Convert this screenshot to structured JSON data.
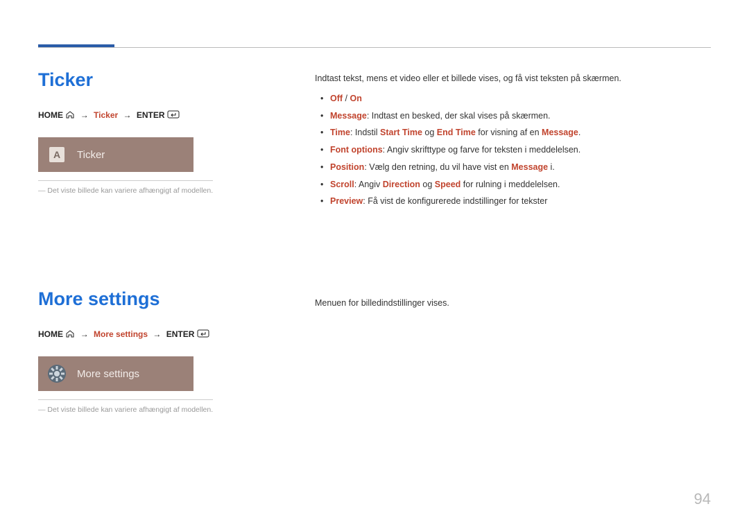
{
  "page_number": "94",
  "ticker": {
    "title": "Ticker",
    "breadcrumb": {
      "home": "HOME",
      "mid": "Ticker",
      "enter": "ENTER"
    },
    "tile_label": "Ticker",
    "tile_letter": "A",
    "note": "Det viste billede kan variere afhængigt af modellen.",
    "intro": "Indtast tekst, mens et video eller et billede vises, og få vist teksten på skærmen.",
    "items": {
      "off_on": {
        "off": "Off",
        "slash": " / ",
        "on": "On"
      },
      "message": {
        "label": "Message",
        "text": ": Indtast en besked, der skal vises på skærmen."
      },
      "time": {
        "label": "Time",
        "p1": ": Indstil ",
        "start": "Start Time",
        "p2": " og ",
        "end": "End Time",
        "p3": " for visning af en ",
        "msg": "Message",
        "p4": "."
      },
      "font": {
        "label": "Font options",
        "text": ": Angiv skrifttype og farve for teksten i meddelelsen."
      },
      "position": {
        "label": "Position",
        "p1": ": Vælg den retning, du vil have vist en ",
        "msg": "Message",
        "p2": " i."
      },
      "scroll": {
        "label": "Scroll",
        "p1": ": Angiv ",
        "dir": "Direction",
        "p2": " og ",
        "spd": "Speed",
        "p3": " for rulning i meddelelsen."
      },
      "preview": {
        "label": "Preview",
        "text": ": Få vist de konfigurerede indstillinger for tekster"
      }
    }
  },
  "more": {
    "title": "More settings",
    "breadcrumb": {
      "home": "HOME",
      "mid": "More settings",
      "enter": "ENTER"
    },
    "tile_label": "More settings",
    "note": "Det viste billede kan variere afhængigt af modellen.",
    "intro": "Menuen for billedindstillinger vises."
  }
}
